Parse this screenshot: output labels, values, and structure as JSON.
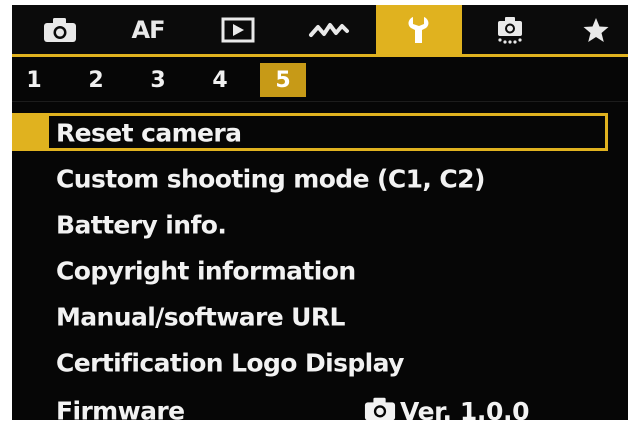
{
  "theme": {
    "accent": "#e0b21f",
    "background": "#060606",
    "text": "#f2f2f2"
  },
  "tabs": [
    {
      "icon": "camera-icon",
      "label": ""
    },
    {
      "icon": "",
      "label": "AF"
    },
    {
      "icon": "play-icon",
      "label": ""
    },
    {
      "icon": "wireless-icon",
      "label": ""
    },
    {
      "icon": "wrench-icon",
      "label": "",
      "active": true
    },
    {
      "icon": "custom-camera-icon",
      "label": ""
    },
    {
      "icon": "star-icon",
      "label": ""
    }
  ],
  "pages": [
    "1",
    "2",
    "3",
    "4",
    "5"
  ],
  "active_page": "5",
  "menu": {
    "items": [
      "Reset camera",
      "Custom shooting mode (C1, C2)",
      "Battery info.",
      "Copyright information",
      "Manual/software URL",
      "Certification Logo Display",
      "Firmware"
    ],
    "selected_index": 0,
    "firmware_version": "Ver. 1.0.0",
    "firmware_icon": "camera-icon"
  }
}
